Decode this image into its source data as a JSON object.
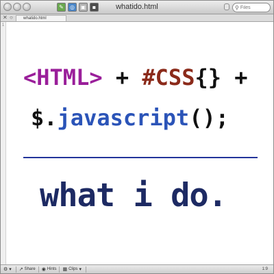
{
  "window": {
    "title": "whatido.html"
  },
  "toolbar": {
    "icons": [
      "edit-icon",
      "globe-icon",
      "lock-icon",
      "terminal-icon"
    ],
    "search_placeholder": "Files"
  },
  "tabbar": {
    "tab_label": "whatido.html"
  },
  "editor": {
    "line_number": "1",
    "line1": {
      "tag": "<HTML>",
      "plus1": " + ",
      "css": "#CSS",
      "braces": "{}",
      "plus2": " +"
    },
    "line2": {
      "prefix": "$.",
      "js": "javascript",
      "suffix": "();"
    },
    "tagline": "what i do."
  },
  "statusbar": {
    "share_label": "Share",
    "hints_label": "Hints",
    "clips_label": "Clips",
    "position": "1:9"
  },
  "colors": {
    "html_tag": "#9a1f9a",
    "css_selector": "#8b2a1a",
    "javascript": "#2b54b8",
    "divider": "#22339a",
    "tagline": "#1d2a63"
  }
}
